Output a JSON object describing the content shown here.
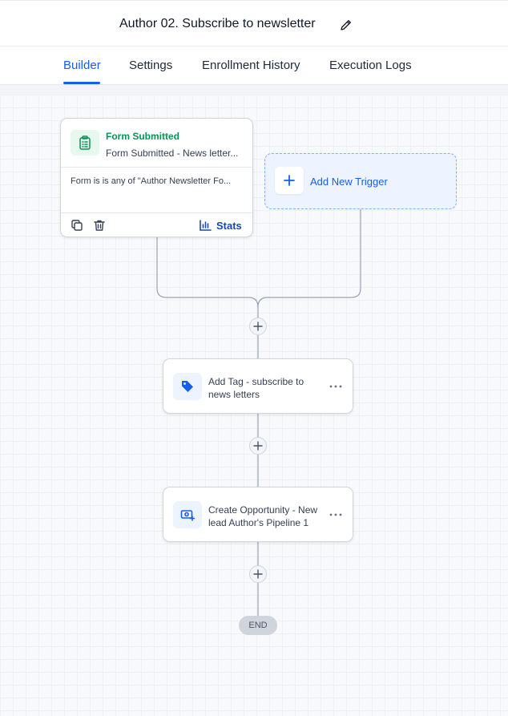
{
  "header": {
    "title": "Author 02. Subscribe to newsletter",
    "edit_icon": "pencil-icon"
  },
  "tabs": [
    {
      "label": "Builder",
      "active": true
    },
    {
      "label": "Settings",
      "active": false
    },
    {
      "label": "Enrollment History",
      "active": false
    },
    {
      "label": "Execution Logs",
      "active": false
    }
  ],
  "trigger": {
    "icon": "clipboard-list-icon",
    "title": "Form Submitted",
    "subtitle": "Form Submitted - News letter...",
    "condition": "Form is is any of \"Author Newsletter Fo...",
    "stats_label": "Stats"
  },
  "add_trigger": {
    "label": "Add New Trigger"
  },
  "actions": [
    {
      "icon": "tag-icon",
      "label": "Add Tag - subscribe to news letters"
    },
    {
      "icon": "opportunity-icon",
      "label": "Create Opportunity - New lead Author's Pipeline 1"
    }
  ],
  "end_label": "END",
  "colors": {
    "accent": "#155eef",
    "trigger_green": "#079455",
    "stats_blue": "#1849a9"
  }
}
